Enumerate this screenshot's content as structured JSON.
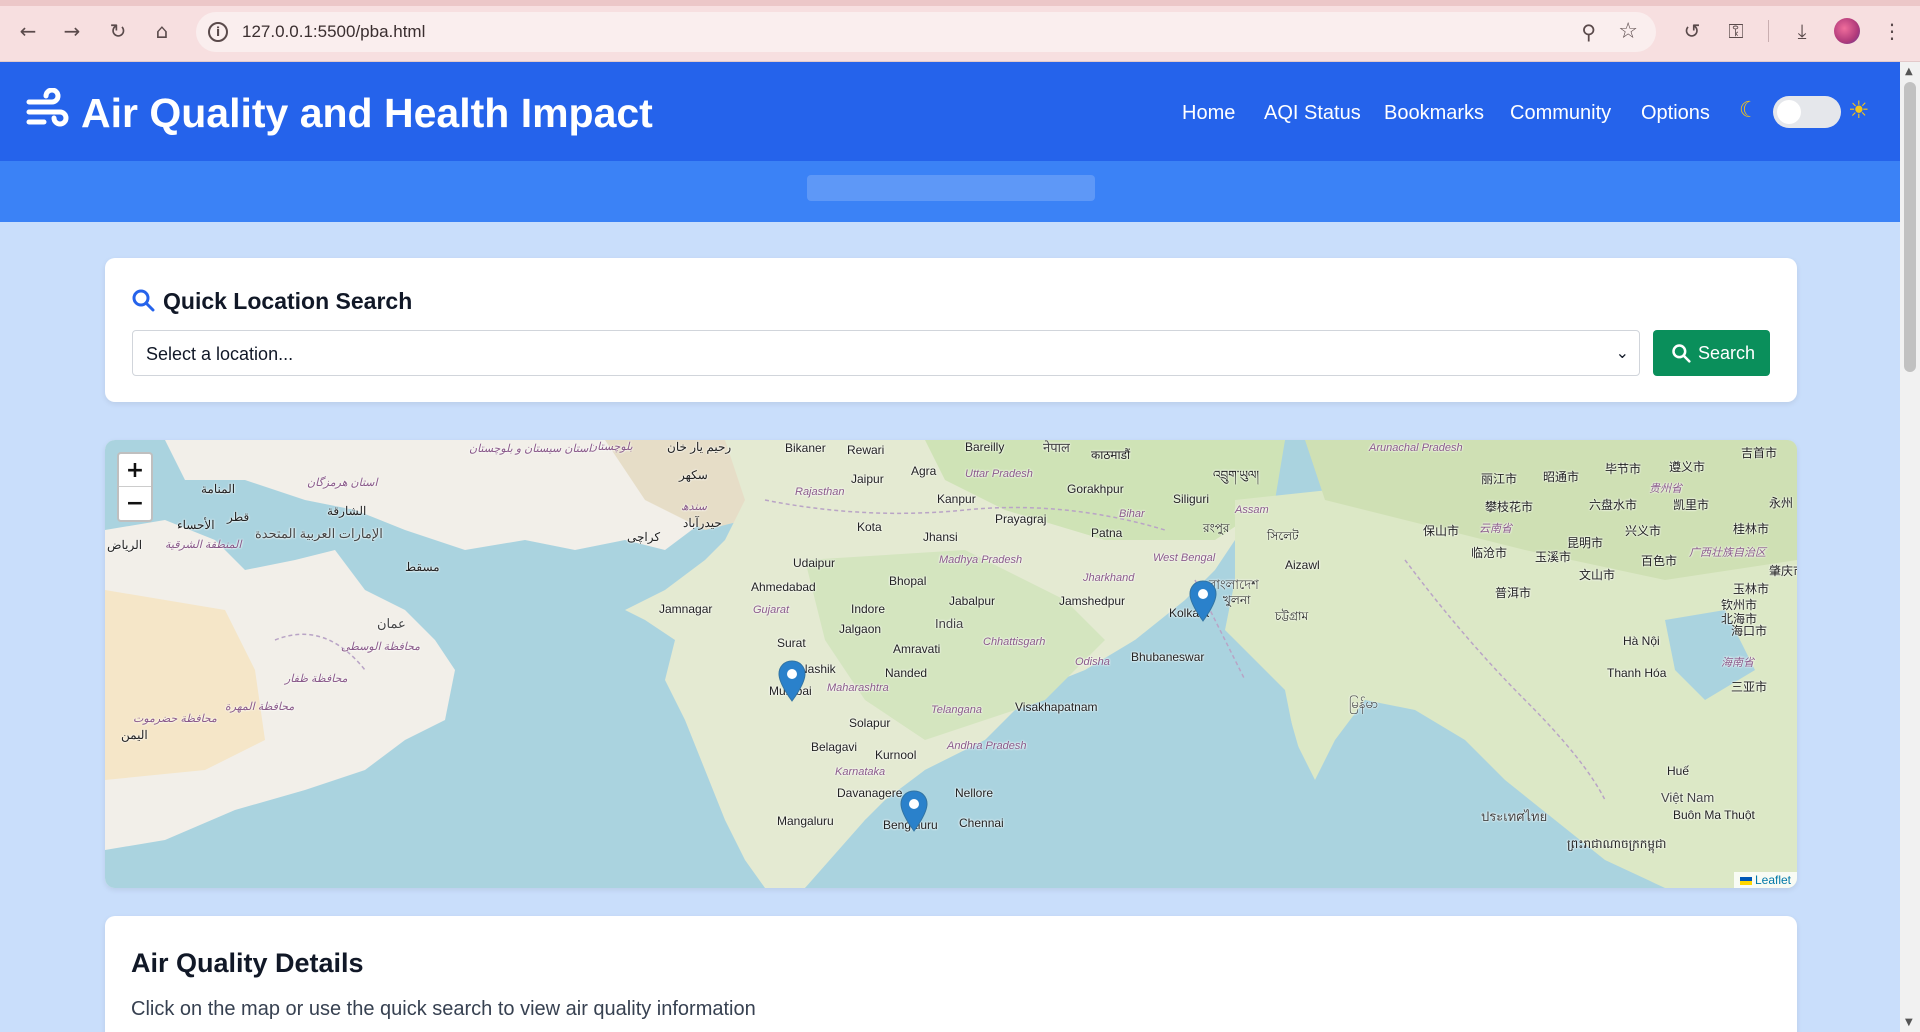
{
  "browser": {
    "url": "127.0.0.1:5500/pba.html"
  },
  "header": {
    "title": "Air Quality and Health Impact",
    "nav": [
      "Home",
      "AQI Status",
      "Bookmarks",
      "Community",
      "Options"
    ],
    "theme_toggle_on": false
  },
  "quick_search": {
    "title": "Quick Location Search",
    "select_value": "Select a location...",
    "button_label": "Search"
  },
  "map": {
    "attribution": "Leaflet",
    "zoom_in": "+",
    "zoom_out": "−",
    "markers": [
      "Mumbai",
      "Kolkata",
      "Bengaluru"
    ],
    "labels": {
      "bikaner": "Bikaner",
      "rewari": "Rewari",
      "bareilly": "Bareilly",
      "nepal": "नेपाल",
      "kathmandu": "काठमाडौं",
      "jaipur": "Jaipur",
      "agra": "Agra",
      "uttar_pradesh": "Uttar Pradesh",
      "gorakhpur": "Gorakhpur",
      "siliguri": "Siliguri",
      "rajasthan": "Rajasthan",
      "kanpur": "Kanpur",
      "bihar": "Bihar",
      "prayagraj": "Prayagraj",
      "kota": "Kota",
      "jhansi": "Jhansi",
      "patna": "Patna",
      "udaipur": "Udaipur",
      "madhya_pradesh": "Madhya Pradesh",
      "west_bengal": "West Bengal",
      "jharkhand": "Jharkhand",
      "ahmedabad": "Ahmedabad",
      "bhopal": "Bhopal",
      "jabalpur": "Jabalpur",
      "jamshedpur": "Jamshedpur",
      "kolkata": "Kolkata",
      "jamnagar": "Jamnagar",
      "gujarat": "Gujarat",
      "indore": "Indore",
      "india": "India",
      "jalgaon": "Jalgaon",
      "chhattisgarh": "Chhattisgarh",
      "surat": "Surat",
      "amravati": "Amravati",
      "nashik": "Nashik",
      "odisha": "Odisha",
      "bhubaneswar": "Bhubaneswar",
      "nanded": "Nanded",
      "mumbai": "Mumbai",
      "maharashtra": "Maharashtra",
      "solapur": "Solapur",
      "telangana": "Telangana",
      "visakhapatnam": "Visakhapatnam",
      "belagavi": "Belagavi",
      "kurnool": "Kurnool",
      "andhra_pradesh": "Andhra Pradesh",
      "karnataka": "Karnataka",
      "davanagere": "Davanagere",
      "nellore": "Nellore",
      "mangaluru": "Mangaluru",
      "bengaluru": "Bengaluru",
      "chennai": "Chennai",
      "aizawl": "Aizawl",
      "arunachal": "Arunachal Pradesh",
      "assam": "Assam",
      "kunming": "昆明市",
      "ha_noi": "Hà Nội",
      "thanh_hoa": "Thanh Hóa",
      "hue": "Huế",
      "viet_nam": "Việt Nam",
      "buon_ma_thuot": "Buôn Ma Thuột",
      "lijiang": "丽江市",
      "zhaotong": "昭通市",
      "bijie": "毕节市",
      "zunyi": "遵义市",
      "guiyang_area": "贵州省",
      "panzhihua": "攀枝花市",
      "liupanshui": "六盘水市",
      "kaili": "凯里市",
      "yunnan": "云南省",
      "baoshan": "保山市",
      "xingyi": "兴义市",
      "lincang": "临沧市",
      "yuxi": "玉溪市",
      "guangxi": "广西壮族自治区",
      "puer": "普洱市",
      "wenshan": "文山市",
      "baise": "百色市",
      "yulin": "玉林市",
      "haikou": "海口市",
      "sanya": "三亚市",
      "hainan": "海南省",
      "yongzhou": "永州",
      "guilin": "桂林市",
      "zhaoqing": "肇庆市",
      "jishou": "吉首市",
      "qinzhou": "钦州市",
      "beihai": "北海市",
      "karachi": "كراچی",
      "muscat": "مسقط",
      "oman": "عمان",
      "riyadh": "الرياض",
      "uae": "الإمارات العربية المتحدة",
      "doha": "قطر",
      "manama": "المنامة",
      "sharjah": "الشارقة",
      "ahsa": "الأحساء",
      "eastern": "المنطقة الشرقية",
      "dhofar": "محافظة ظفار",
      "wusta": "محافظة الوسطى",
      "mahra": "محافظة المهرة",
      "hadramout": "محافظة حضرموت",
      "yemen": "اليمن",
      "sukkur": "سکھر",
      "hyderabad_pk": "حیدرآباد",
      "sindh": "سندھ",
      "rahim_yar_khan": "رحیم یار خان",
      "balochistan": "بلوچستان",
      "sistan": "استان سیستان و بلوچستان",
      "hormozgan": "استان هرمزگان",
      "bangladesh": "বাংলাদেশ",
      "khulna": "খুলনা",
      "rangpur": "রংপুর",
      "sylhet": "সিলেট",
      "chattogram": "চট্টগ্রাম",
      "bhutan": "འབྲུག་ཡུལ།",
      "myanmar": "မြန်မာ",
      "thailand": "ประเทศไทย",
      "cambodia": "ព្រះរាជាណាចក្រកម្ពុជា"
    }
  },
  "details": {
    "title": "Air Quality Details",
    "text": "Click on the map or use the quick search to view air quality information"
  }
}
